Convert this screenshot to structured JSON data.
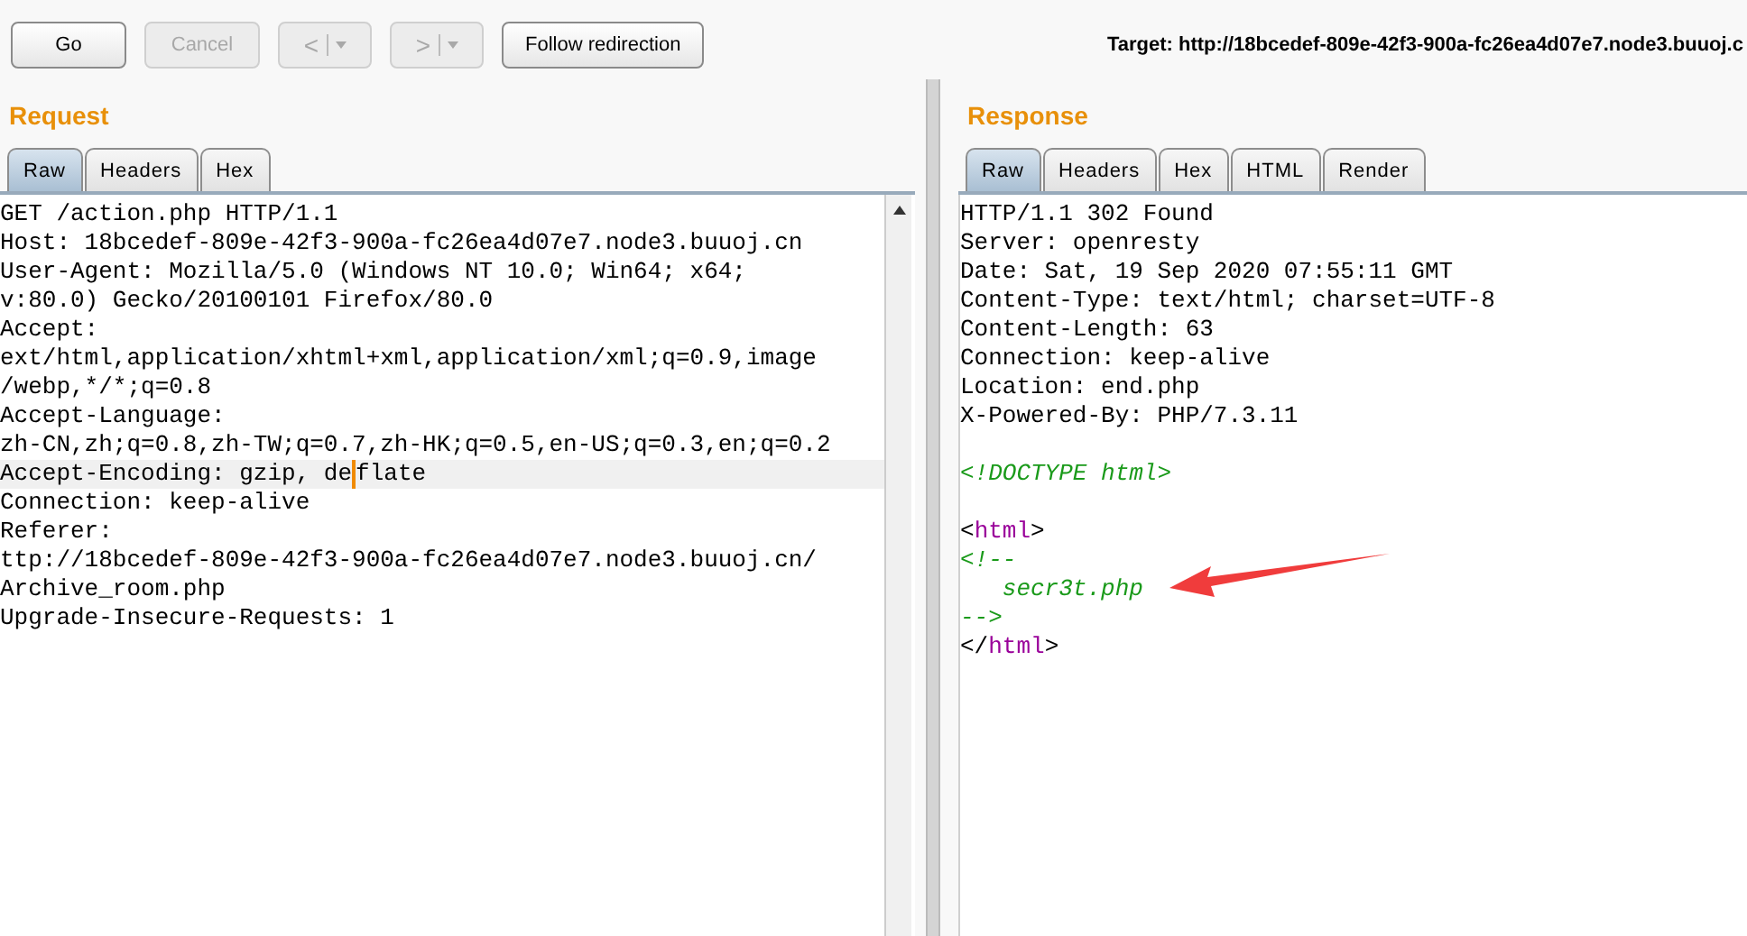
{
  "toolbar": {
    "buttons": [
      {
        "kind": "text",
        "label": "Go",
        "disabled": false
      },
      {
        "kind": "text",
        "label": "Cancel",
        "disabled": true
      },
      {
        "kind": "nav",
        "label": "<",
        "disabled": true
      },
      {
        "kind": "nav",
        "label": ">",
        "disabled": true
      },
      {
        "kind": "text",
        "label": "Follow redirection",
        "disabled": false
      }
    ],
    "target": "Target: http://18bcedef-809e-42f3-900a-fc26ea4d07e7.node3.buuoj.c"
  },
  "request": {
    "title": "Request",
    "tabs": [
      {
        "label": "Raw",
        "selected": true
      },
      {
        "label": "Headers",
        "selected": false
      },
      {
        "label": "Hex",
        "selected": false
      }
    ],
    "lines": [
      {
        "kind": "code",
        "highlighted": false,
        "segments": [
          {
            "kind": "plain",
            "text": "GET /action.php HTTP/1.1"
          }
        ]
      },
      {
        "kind": "code",
        "highlighted": false,
        "segments": [
          {
            "kind": "plain",
            "text": "Host: 18bcedef-809e-42f3-900a-fc26ea4d07e7.node3.buuoj.cn"
          }
        ]
      },
      {
        "kind": "code",
        "highlighted": false,
        "segments": [
          {
            "kind": "plain",
            "text": "User-Agent: Mozilla/5.0 (Windows NT 10.0; Win64; x64;"
          }
        ]
      },
      {
        "kind": "code",
        "highlighted": false,
        "segments": [
          {
            "kind": "plain",
            "text": "v:80.0) Gecko/20100101 Firefox/80.0"
          }
        ]
      },
      {
        "kind": "code",
        "highlighted": false,
        "segments": [
          {
            "kind": "plain",
            "text": "Accept:"
          }
        ]
      },
      {
        "kind": "code",
        "highlighted": false,
        "segments": [
          {
            "kind": "plain",
            "text": "ext/html,application/xhtml+xml,application/xml;q=0.9,image"
          }
        ]
      },
      {
        "kind": "code",
        "highlighted": false,
        "segments": [
          {
            "kind": "plain",
            "text": "/webp,*/*;q=0.8"
          }
        ]
      },
      {
        "kind": "code",
        "highlighted": false,
        "segments": [
          {
            "kind": "plain",
            "text": "Accept-Language:"
          }
        ]
      },
      {
        "kind": "code",
        "highlighted": false,
        "segments": [
          {
            "kind": "plain",
            "text": "zh-CN,zh;q=0.8,zh-TW;q=0.7,zh-HK;q=0.5,en-US;q=0.3,en;q=0.2"
          }
        ]
      },
      {
        "kind": "code",
        "highlighted": true,
        "segments": [
          {
            "kind": "plain",
            "text": "Accept-Encoding: gzip, de"
          },
          {
            "kind": "cursor"
          },
          {
            "kind": "plain",
            "text": "flate"
          }
        ]
      },
      {
        "kind": "code",
        "highlighted": false,
        "segments": [
          {
            "kind": "plain",
            "text": "Connection: keep-alive"
          }
        ]
      },
      {
        "kind": "code",
        "highlighted": false,
        "segments": [
          {
            "kind": "plain",
            "text": "Referer:"
          }
        ]
      },
      {
        "kind": "code",
        "highlighted": false,
        "segments": [
          {
            "kind": "plain",
            "text": "ttp://18bcedef-809e-42f3-900a-fc26ea4d07e7.node3.buuoj.cn/"
          }
        ]
      },
      {
        "kind": "code",
        "highlighted": false,
        "segments": [
          {
            "kind": "plain",
            "text": "Archive_room.php"
          }
        ]
      },
      {
        "kind": "code",
        "highlighted": false,
        "segments": [
          {
            "kind": "plain",
            "text": "Upgrade-Insecure-Requests: 1"
          }
        ]
      }
    ]
  },
  "response": {
    "title": "Response",
    "tabs": [
      {
        "label": "Raw",
        "selected": true
      },
      {
        "label": "Headers",
        "selected": false
      },
      {
        "label": "Hex",
        "selected": false
      },
      {
        "label": "HTML",
        "selected": false
      },
      {
        "label": "Render",
        "selected": false
      }
    ],
    "lines": [
      {
        "kind": "code",
        "highlighted": false,
        "segments": [
          {
            "kind": "plain",
            "text": "HTTP/1.1 302 Found"
          }
        ]
      },
      {
        "kind": "code",
        "highlighted": false,
        "segments": [
          {
            "kind": "plain",
            "text": "Server: openresty"
          }
        ]
      },
      {
        "kind": "code",
        "highlighted": false,
        "segments": [
          {
            "kind": "plain",
            "text": "Date: Sat, 19 Sep 2020 07:55:11 GMT"
          }
        ]
      },
      {
        "kind": "code",
        "highlighted": false,
        "segments": [
          {
            "kind": "plain",
            "text": "Content-Type: text/html; charset=UTF-8"
          }
        ]
      },
      {
        "kind": "code",
        "highlighted": false,
        "segments": [
          {
            "kind": "plain",
            "text": "Content-Length: 63"
          }
        ]
      },
      {
        "kind": "code",
        "highlighted": false,
        "segments": [
          {
            "kind": "plain",
            "text": "Connection: keep-alive"
          }
        ]
      },
      {
        "kind": "code",
        "highlighted": false,
        "segments": [
          {
            "kind": "plain",
            "text": "Location: end.php"
          }
        ]
      },
      {
        "kind": "code",
        "highlighted": false,
        "segments": [
          {
            "kind": "plain",
            "text": "X-Powered-By: PHP/7.3.11"
          }
        ]
      },
      {
        "kind": "blank"
      },
      {
        "kind": "code",
        "highlighted": false,
        "segments": [
          {
            "kind": "comment",
            "text": "<!DOCTYPE html>"
          }
        ]
      },
      {
        "kind": "blank"
      },
      {
        "kind": "code",
        "highlighted": false,
        "segments": [
          {
            "kind": "plain",
            "text": "<"
          },
          {
            "kind": "tag",
            "text": "html"
          },
          {
            "kind": "plain",
            "text": ">"
          }
        ]
      },
      {
        "kind": "code",
        "highlighted": false,
        "segments": [
          {
            "kind": "comment",
            "text": "<!--"
          }
        ]
      },
      {
        "kind": "code",
        "highlighted": false,
        "segments": [
          {
            "kind": "comment",
            "text": "   secr3t.php"
          }
        ]
      },
      {
        "kind": "code",
        "highlighted": false,
        "segments": [
          {
            "kind": "comment",
            "text": "-->"
          }
        ]
      },
      {
        "kind": "code",
        "highlighted": false,
        "segments": [
          {
            "kind": "plain",
            "text": "</"
          },
          {
            "kind": "tag",
            "text": "html"
          },
          {
            "kind": "plain",
            "text": ">"
          }
        ]
      }
    ]
  }
}
